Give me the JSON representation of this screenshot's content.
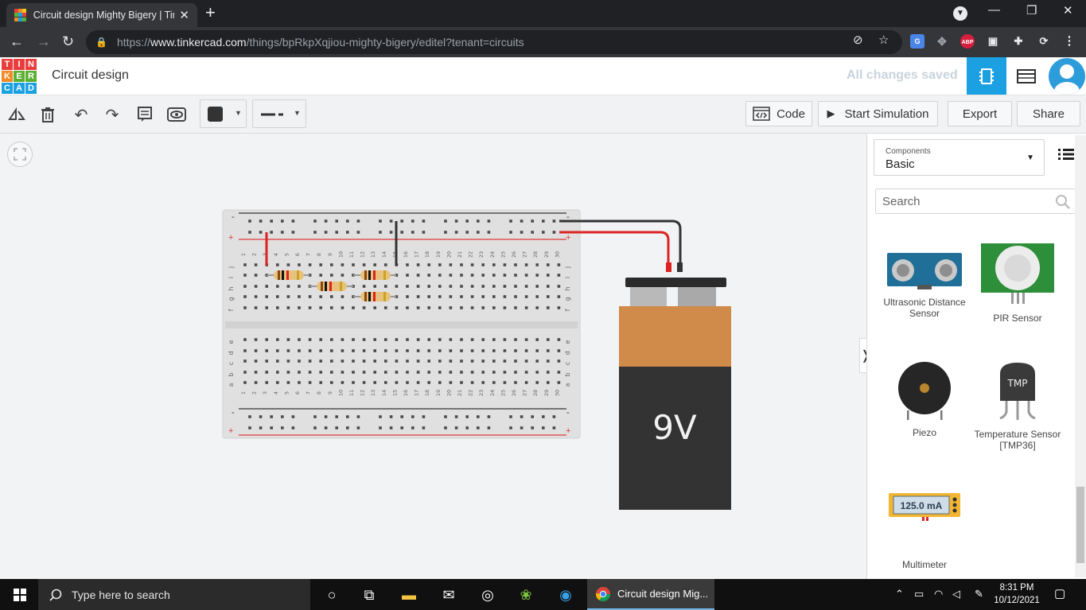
{
  "browser": {
    "tab_title": "Circuit design Mighty Bigery | Tin",
    "url_prefix": "https://",
    "url_host": "www.tinkercad.com",
    "url_path": "/things/bpRkpXqjiou-mighty-bigery/editel?tenant=circuits",
    "ext_abp": "ABP"
  },
  "header": {
    "logo_letters": [
      "T",
      "I",
      "N",
      "K",
      "E",
      "R",
      "C",
      "A",
      "D"
    ],
    "title": "Circuit design",
    "save_status": "All changes saved"
  },
  "toolbar": {
    "code_label": "Code",
    "simulate_label": "Start Simulation",
    "export_label": "Export",
    "share_label": "Share"
  },
  "canvas": {
    "battery_label": "9V",
    "breadboard_columns": [
      "1",
      "2",
      "3",
      "4",
      "5",
      "6",
      "7",
      "8",
      "9",
      "10",
      "11",
      "12",
      "13",
      "14",
      "15",
      "16",
      "17",
      "18",
      "19",
      "20",
      "21",
      "22",
      "23",
      "24",
      "25",
      "26",
      "27",
      "28",
      "29",
      "30"
    ],
    "rows_top": [
      "j",
      "i",
      "h",
      "g",
      "f"
    ],
    "rows_bottom": [
      "e",
      "d",
      "c",
      "b",
      "a"
    ],
    "rail_minus": "-",
    "rail_plus": "+"
  },
  "panel": {
    "components_label": "Components",
    "components_value": "Basic",
    "search_placeholder": "Search",
    "items": [
      {
        "label": "Ultrasonic Distance Sensor"
      },
      {
        "label": "PIR Sensor"
      },
      {
        "label": "Piezo"
      },
      {
        "label": "Temperature Sensor [TMP36]"
      },
      {
        "label": "Multimeter"
      }
    ],
    "multimeter_display": "125.0 mA",
    "tmp_chip_label": "TMP"
  },
  "taskbar": {
    "search_text": "Type here to search",
    "chrome_task_title": "Circuit design Mig...",
    "time": "8:31 PM",
    "date": "10/12/2021"
  },
  "colors": {
    "tinkercad_blue": "#1ba1e2",
    "rail_red": "#e03a3a",
    "battery_copper": "#d08a4a",
    "battery_body": "#333333"
  }
}
